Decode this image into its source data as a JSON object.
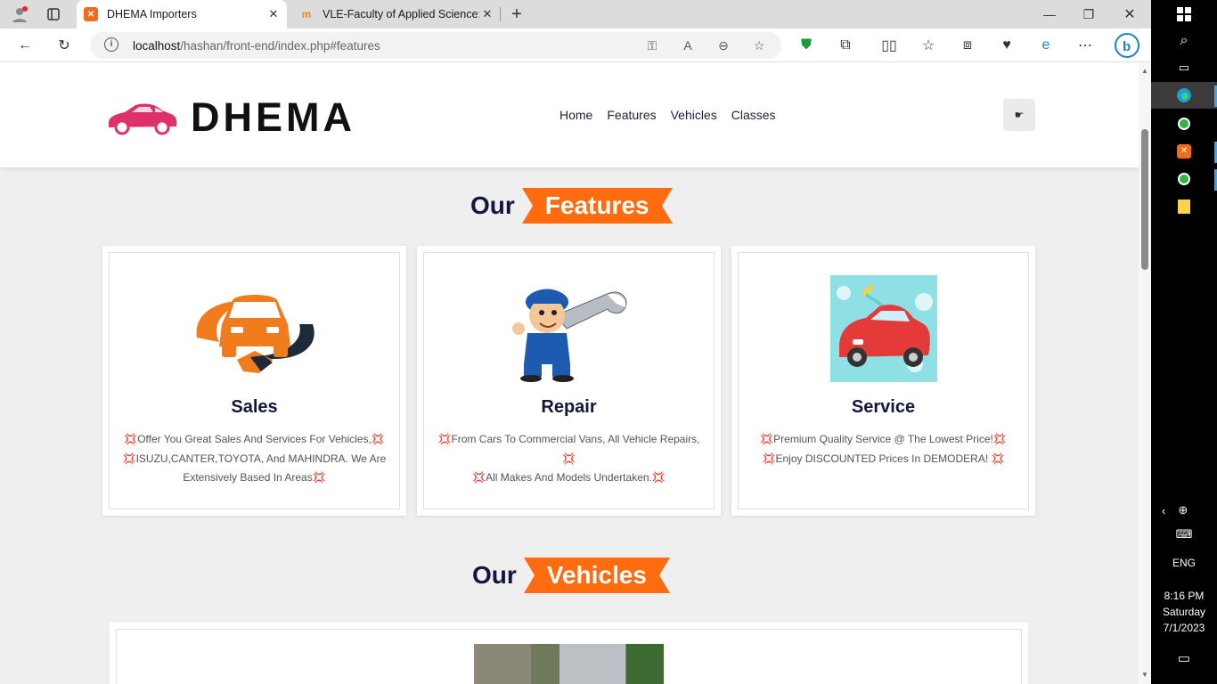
{
  "browser": {
    "tabs": [
      {
        "title": "DHEMA Importers",
        "favicon": "xampp-icon",
        "active": true
      },
      {
        "title": "VLE-Faculty of Applied Science: L",
        "favicon": "moodle-icon",
        "active": false
      }
    ],
    "url_host": "localhost",
    "url_path": "/hashan/front-end/index.php#features",
    "colors": {
      "accent": "#ff6b0f",
      "navy": "#141540"
    }
  },
  "site": {
    "brand": "DHEMA",
    "nav": [
      "Home",
      "Features",
      "Vehicles",
      "Classes"
    ],
    "user_button_icon": "☛",
    "features_title": {
      "prefix": "Our",
      "highlight": "Features"
    },
    "features": [
      {
        "title": "Sales",
        "image": "handshake-car-image",
        "line1": "💢Offer You Great Sales And Services For Vehicles,💢",
        "line2": "💢ISUZU,CANTER,TOYOTA, And MAHINDRA. We Are",
        "line3": "Extensively Based In Areas💢"
      },
      {
        "title": "Repair",
        "image": "mechanic-wrench-image",
        "line1": "💢From Cars To Commercial Vans, All Vehicle Repairs,",
        "line2": "💢",
        "line3": "💢All Makes And Models Undertaken.💢"
      },
      {
        "title": "Service",
        "image": "car-wash-image",
        "line1": "💢Premium Quality Service @ The Lowest Price!💢",
        "line2": "💢Enjoy DISCOUNTED Prices In DEMODERA! 💢",
        "line3": ""
      }
    ],
    "vehicles_title": {
      "prefix": "Our",
      "highlight": "Vehicles"
    }
  },
  "taskbar": {
    "language": "ENG",
    "time": "8:16 PM",
    "day": "Saturday",
    "date": "7/1/2023"
  }
}
